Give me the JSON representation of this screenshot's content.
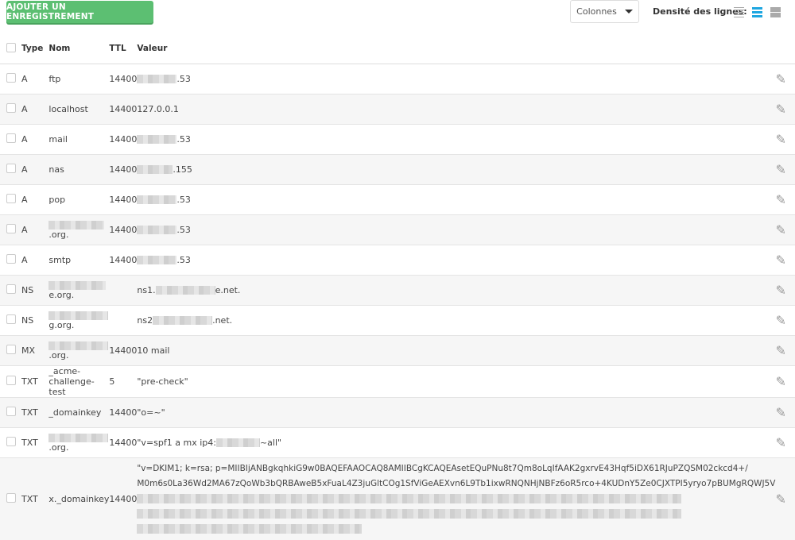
{
  "toolbar": {
    "add_label": "AJOUTER UN ENREGISTREMENT",
    "columns_label": "Colonnes",
    "density_label": "Densité des lignes:",
    "density_active": "medium",
    "accent": "#1ea6e0",
    "add_color": "#5cbf72"
  },
  "table": {
    "headers": [
      "Type",
      "Nom",
      "TTL",
      "Valeur"
    ],
    "rows": [
      {
        "type": "A",
        "name": "ftp",
        "ttl": "14400",
        "value": ".53"
      },
      {
        "type": "A",
        "name": "localhost",
        "ttl": "14400",
        "value": "127.0.0.1"
      },
      {
        "type": "A",
        "name": "mail",
        "ttl": "14400",
        "value": ".53"
      },
      {
        "type": "A",
        "name": "nas",
        "ttl": "14400",
        "value": ".155"
      },
      {
        "type": "A",
        "name": "pop",
        "ttl": "14400",
        "value": ".53"
      },
      {
        "type": "A",
        "name": ".org.",
        "ttl": "14400",
        "value": ".53"
      },
      {
        "type": "A",
        "name": "smtp",
        "ttl": "14400",
        "value": ".53"
      },
      {
        "type": "NS",
        "name": "e.org.",
        "ttl": "",
        "value_prefix": "ns1.",
        "value": "e.net."
      },
      {
        "type": "NS",
        "name": "g.org.",
        "ttl": "",
        "value_prefix": "ns2",
        "value": ".net."
      },
      {
        "type": "MX",
        "name": ".org.",
        "ttl": "14400",
        "value": "10 mail"
      },
      {
        "type": "TXT",
        "name": "_acme-challenge-test",
        "ttl": "5",
        "value": "\"pre-check\""
      },
      {
        "type": "TXT",
        "name": "_domainkey",
        "ttl": "14400",
        "value": "\"o=~\""
      },
      {
        "type": "TXT",
        "name": ".org.",
        "ttl": "14400",
        "value_prefix": "\"v=spf1 a mx ip4:",
        "value": "~all\""
      },
      {
        "type": "TXT",
        "name": "x._domainkey",
        "ttl": "14400",
        "value_line1": "\"v=DKIM1; k=rsa; p=MIIBIjANBgkqhkiG9w0BAQEFAAOCAQ8AMIIBCgKCAQEAsetEQuPNu8t7Qm8oLqIfAAK2gxrvE43Hqf5iDX61RJuPZQSM02ckcd4+/",
        "value_line2": "M0m6s0La36Wd2MA67zQoWb3bQRBAweB5xFuaL4Z3juGltCOg1SfViGeAEXvn6L9Tb1ixwRNQNHjNBFz6oR5rco+4KUDnY5Ze0CJXTPI5yryo7pBUMgRQWJ5V"
      }
    ]
  }
}
